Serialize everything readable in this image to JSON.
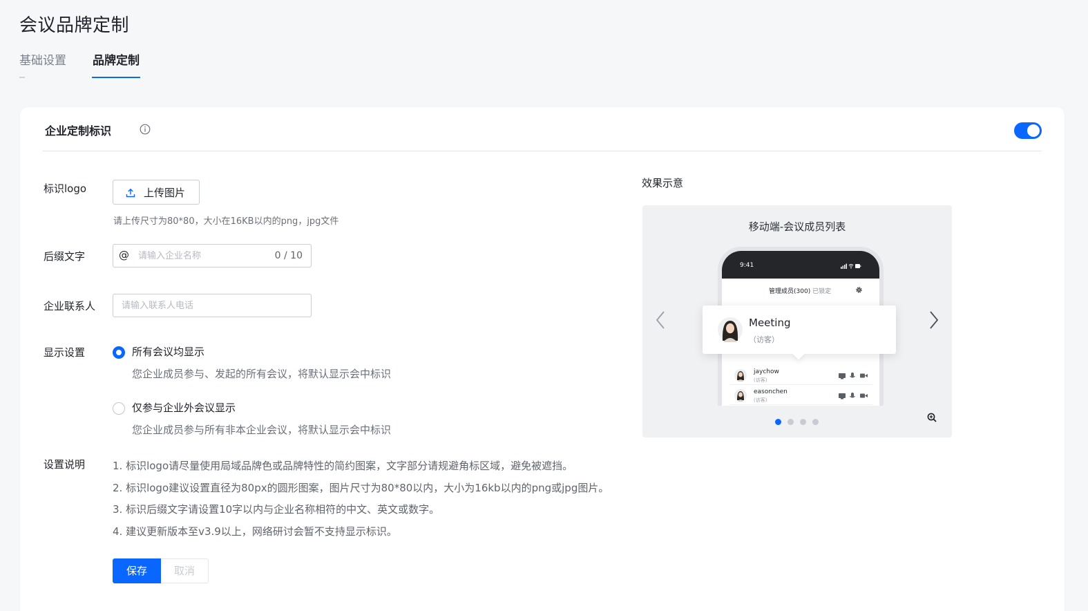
{
  "page": {
    "title": "会议品牌定制"
  },
  "tabs": [
    {
      "label": "基础设置",
      "active": false
    },
    {
      "label": "品牌定制",
      "active": true
    }
  ],
  "section": {
    "title": "企业定制标识",
    "info_icon": "info-icon",
    "toggle_on": true
  },
  "form": {
    "logo": {
      "label": "标识logo",
      "upload_label": "上传图片",
      "hint": "请上传尺寸为80*80，大小在16KB以内的png，jpg文件"
    },
    "suffix": {
      "label": "后缀文字",
      "prefix": "@",
      "value": "",
      "placeholder": "请输入企业名称",
      "counter": "0 / 10"
    },
    "contact": {
      "label": "企业联系人",
      "value": "",
      "placeholder": "请输入联系人电话"
    },
    "display": {
      "label": "显示设置",
      "options": [
        {
          "label": "所有会议均显示",
          "desc": "您企业成员参与、发起的所有会议，将默认显示会中标识",
          "checked": true
        },
        {
          "label": "仅参与企业外会议显示",
          "desc": "您企业成员参与所有非本企业会议，将默认显示会中标识",
          "checked": false
        }
      ]
    },
    "notes": {
      "label": "设置说明",
      "items": [
        "1. 标识logo请尽量使用局域品牌色或品牌特性的简约图案，文字部分请规避角标区域，避免被遮挡。",
        "2. 标识logo建议设置直径为80px的圆形图案，图片尺寸为80*80以内，大小为16kb以内的png或jpg图片。",
        "3. 标识后缀文字请设置10字以内与企业名称相符的中文、英文或数字。",
        "4. 建议更新版本至v3.9以上，网络研讨会暂不支持显示标识。"
      ]
    },
    "save_label": "保存",
    "cancel_label": "取消"
  },
  "preview": {
    "title": "效果示意",
    "caption": "移动端-会议成员列表",
    "phone": {
      "time": "9:41",
      "nav_title": "管理成员(300)",
      "nav_sub": "已锁定",
      "popup_name": "Meeting",
      "popup_tag": "（访客）",
      "members": [
        {
          "name": "jaychow",
          "tag": "(访客)"
        },
        {
          "name": "easonchen",
          "tag": "(访客)"
        }
      ]
    },
    "slide_count": 4,
    "active_slide": 0
  },
  "colors": {
    "accent": "#0966ff",
    "background": "#f6f7f9",
    "text": "#1f2329",
    "muted": "#6b7078"
  }
}
